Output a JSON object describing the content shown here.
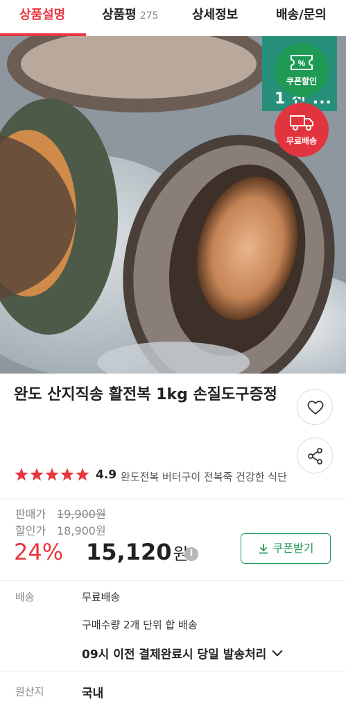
{
  "tabs": [
    {
      "label": "상품설명",
      "count": ""
    },
    {
      "label": "상품평",
      "count": "275"
    },
    {
      "label": "상세정보",
      "count": ""
    },
    {
      "label": "배송/문의",
      "count": ""
    }
  ],
  "hero": {
    "badge_box_text": "1 천 ..."
  },
  "badges": {
    "coupon": "쿠폰할인",
    "shipping": "무료배송"
  },
  "product": {
    "title": "완도 산지직송 활전복 1kg 손질도구증정",
    "rating_value": "4.9",
    "stars": 5,
    "tags": "완도전복 버터구이 전복죽 건강한 식단"
  },
  "price": {
    "list_label": "판매가",
    "list_value": "19,900원",
    "sale_label": "할인가",
    "sale_value": "18,900원",
    "discount_rate": "24%",
    "final_value": "15,120",
    "final_unit": "원",
    "info_icon": "i",
    "coupon_button": "쿠폰받기"
  },
  "shipping": {
    "label": "배송",
    "value": "무료배송",
    "note": "구매수량 2개 단위 합 배송",
    "dispatch": "09시 이전 결제완료시 당일 발송처리"
  },
  "origin": {
    "label": "원산지",
    "value": "국내"
  },
  "colors": {
    "accent": "#e8363f",
    "green": "#1f9a55",
    "teal": "#27907a"
  }
}
